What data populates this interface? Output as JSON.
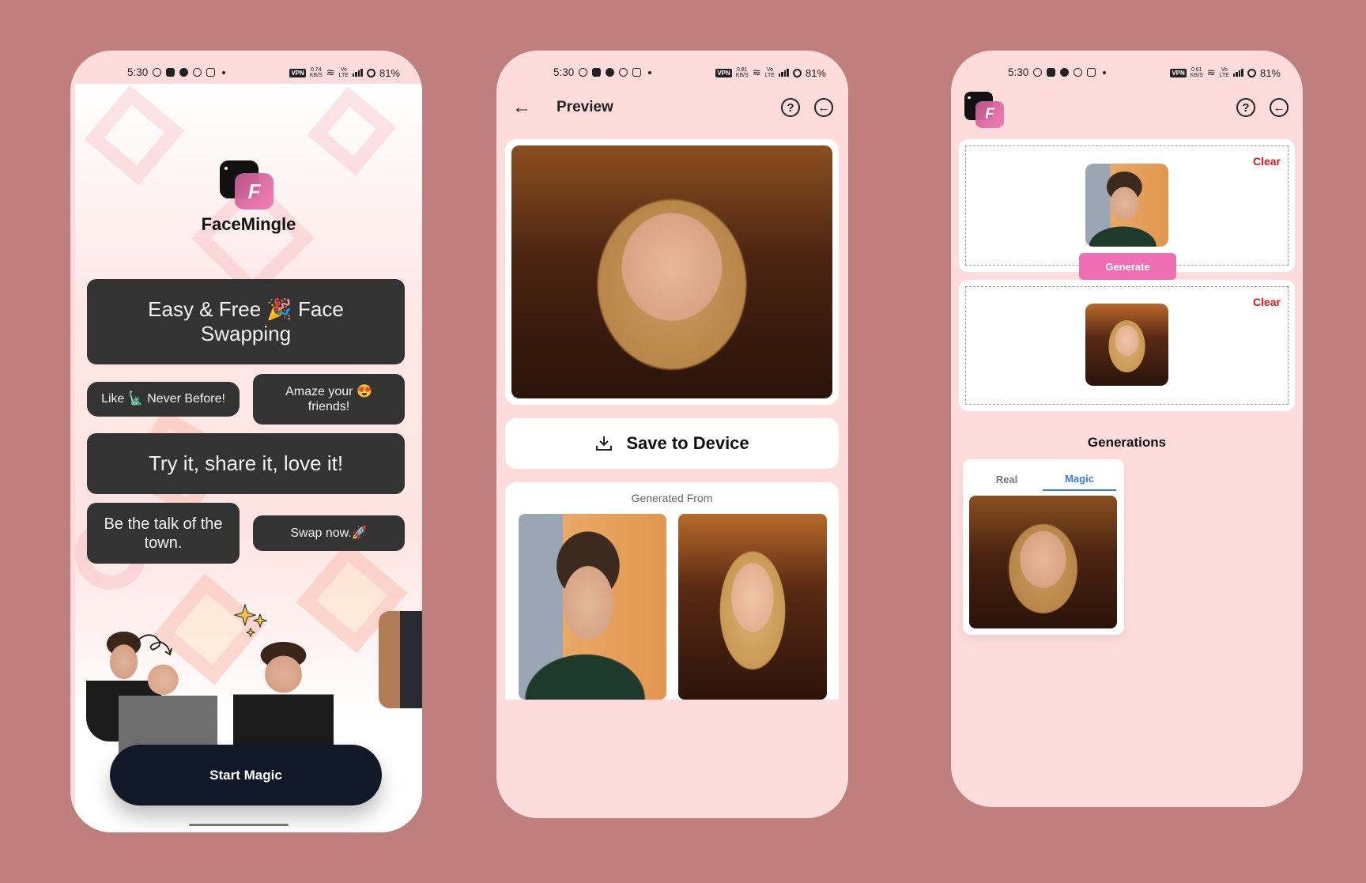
{
  "status_bars": [
    {
      "time": "5:30",
      "speed": "0.74",
      "speed_unit": "KB/S",
      "battery": "81%",
      "vpn": "VPN"
    },
    {
      "time": "5:30",
      "speed": "0.81",
      "speed_unit": "KB/S",
      "battery": "81%",
      "vpn": "VPN"
    },
    {
      "time": "5:30",
      "speed": "0.61",
      "speed_unit": "KB/S",
      "battery": "81%",
      "vpn": "VPN"
    }
  ],
  "welcome": {
    "logo_letter": "F",
    "app_name": "FaceMingle",
    "bubbles": [
      "Easy & Free 🎉 Face Swapping",
      "Like 🗽 Never Before!",
      "Amaze your 😍 friends!",
      "Try it, share it, love it!",
      "Be the talk of the town.",
      "Swap now.🚀"
    ],
    "start_button": "Start Magic"
  },
  "preview": {
    "title": "Preview",
    "back_icon": "←",
    "help_icon": "?",
    "exit_icon": "←",
    "save_button": "Save to Device",
    "generated_from_label": "Generated From"
  },
  "editor": {
    "logo_letter": "F",
    "help_icon": "?",
    "exit_icon": "←",
    "clear_label": "Clear",
    "generate_button": "Generate",
    "generations_title": "Generations",
    "tabs": [
      {
        "label": "Real",
        "active": false
      },
      {
        "label": "Magic",
        "active": true
      }
    ],
    "accent_color": "#f06fb4",
    "tab_active_color": "#3b7be0",
    "clear_color": "#d9151b"
  }
}
